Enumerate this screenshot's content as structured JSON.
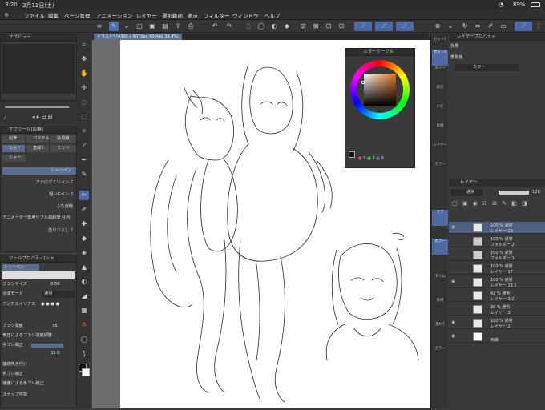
{
  "status": {
    "time": "3:20",
    "date": "2月13日(土)",
    "battery": "89%"
  },
  "menu": [
    "ファイル",
    "編集",
    "ページ管理",
    "アニメーション",
    "レイヤー",
    "選択範囲",
    "表示",
    "フィルター",
    "ウィンドウ",
    "ヘルプ"
  ],
  "subview": {
    "title": "サブビュー"
  },
  "subtool": {
    "title": "サブツール[鉛筆]",
    "tabs": [
      "鉛筆",
      "パステル",
      "効果線",
      "シャー",
      "直線1",
      "ミリペ",
      "シャー"
    ],
    "brushes": [
      "シャーペン",
      "アナログミリペン 2",
      "粗いGペン 3",
      "ふち自機",
      "アニメーター専用サブル風鉛筆 社内",
      "塗りつぶし 2"
    ]
  },
  "toolprop": {
    "title": "ツールプロパティ[シャ",
    "current": "シャーペン",
    "brush_size_label": "ブラシサイズ",
    "brush_size": "0.50",
    "blend_mode_label": "合成モード",
    "blend_mode": "通常",
    "aa_label": "アンチエイリアス",
    "density_label": "ブラシ濃度",
    "density": "76",
    "pressure_density": "筆圧によるブラシ濃度調整",
    "stabilize_label": "手ブレ補正",
    "stabilize": "35.0",
    "continuous": "連続吹き付け",
    "vector_label": "手ブレ補正",
    "pressure_size": "速度による手ブレ補正",
    "snap": "スナップ可能"
  },
  "canvas": {
    "tab": "イラスト* (4300 x 6070px 600dpi 39.4%)"
  },
  "colorcircle": {
    "title": "カラーサークル",
    "readouts": [
      "0",
      "0",
      "0"
    ]
  },
  "rightcol": {
    "labels": [
      "セット1",
      "セット2",
      "タイー",
      "表示",
      "ナビ",
      "素材",
      "レイヤー",
      "カラー",
      "サブ",
      "カラー",
      "タイム",
      "素材",
      "素材1",
      "カラー"
    ]
  },
  "layerprop": {
    "title": "レイヤープロパティ",
    "effect": "効果",
    "expr_label": "表現色",
    "expr_value": "カラー"
  },
  "layers": {
    "title": "レイヤー",
    "blend": "通常",
    "opacity": "100",
    "rows": [
      {
        "pct": "100 %  通常",
        "name": "レイヤー 13",
        "selected": true
      },
      {
        "pct": "100 %  通常",
        "name": "フォルダー 2",
        "selected": false
      },
      {
        "pct": "100 %  通常",
        "name": "フォルダー 1",
        "selected": false
      },
      {
        "pct": "100 %  通常",
        "name": "レイヤー 17",
        "selected": false
      },
      {
        "pct": "100 %  通常",
        "name": "レイヤー 13 2",
        "selected": false
      },
      {
        "pct": "42 %  通常",
        "name": "レイヤー 3 2",
        "selected": false
      },
      {
        "pct": "30 %  通常",
        "name": "レイヤー 3",
        "selected": false
      },
      {
        "pct": "100 %  通常",
        "name": "レイヤー 2",
        "selected": false
      },
      {
        "pct": "",
        "name": "用紙",
        "selected": false
      }
    ]
  },
  "colors": {
    "accent": "#5b7fc6",
    "ink": "#2a2a2a",
    "paper": "#ffffff"
  }
}
